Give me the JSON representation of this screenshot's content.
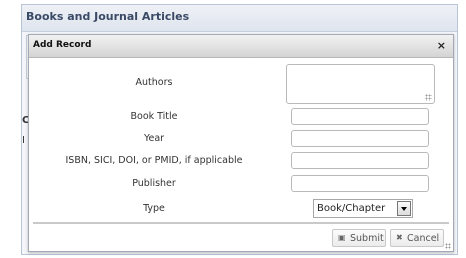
{
  "page": {
    "title": "Books and Journal Articles",
    "bg_letters": [
      "C",
      "I"
    ]
  },
  "dialog": {
    "title": "Add Record",
    "close_glyph": "×",
    "fields": {
      "authors_label": "Authors",
      "authors_value": "",
      "book_title_label": "Book Title",
      "book_title_value": "",
      "year_label": "Year",
      "year_value": "",
      "isbn_label": "ISBN, SICI, DOI, or PMID, if applicable",
      "isbn_value": "",
      "publisher_label": "Publisher",
      "publisher_value": "",
      "type_label": "Type",
      "type_selected": "Book/Chapter"
    },
    "buttons": {
      "submit_label": "Submit",
      "submit_icon": "save-icon",
      "cancel_label": "Cancel",
      "cancel_icon": "close-icon"
    }
  }
}
